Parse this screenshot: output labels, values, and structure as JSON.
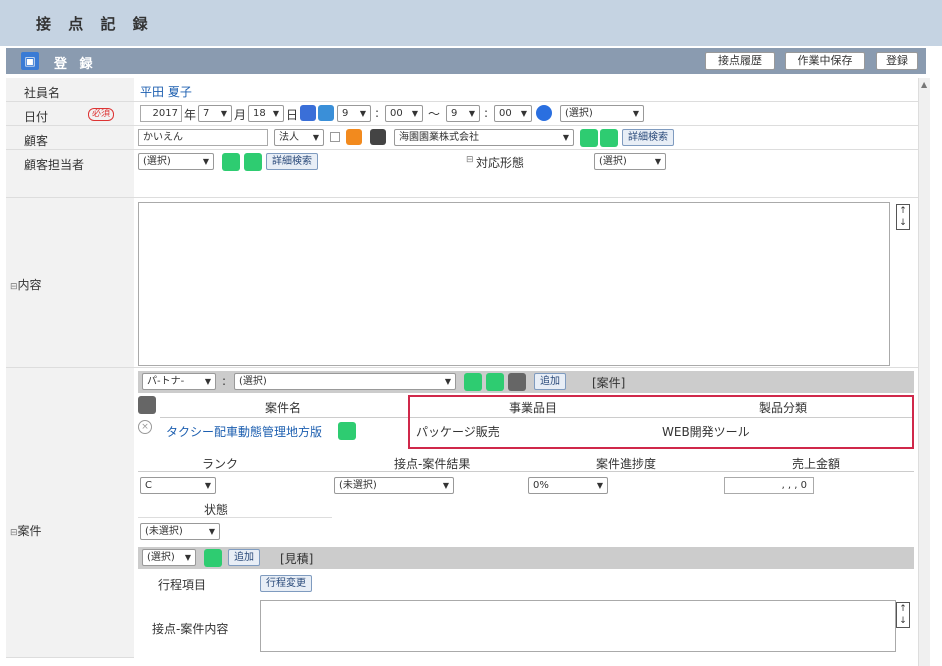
{
  "header": {
    "title": "接 点 記 録"
  },
  "register_bar": {
    "label": "登 録",
    "history": "接点履歴",
    "save_wip": "作業中保存",
    "register": "登録"
  },
  "labels": {
    "employee": "社員名",
    "date": "日付",
    "required": "必須",
    "customer": "顧客",
    "contact_person": "顧客担当者",
    "content": "内容",
    "case": "案件"
  },
  "employee_name": "平田 夏子",
  "date_row": {
    "year": "2017",
    "y": "年",
    "month": "7",
    "m": "月",
    "day": "18",
    "d": "日",
    "h1": "9",
    "c1": ":",
    "min1": "00",
    "tilde": "〜",
    "h2": "9",
    "c2": ":",
    "min2": "00",
    "select": "(選択)"
  },
  "customer_row": {
    "name": "かいえん",
    "type": "法人",
    "company": "海園園業株式会社",
    "detail_search": "詳細検索"
  },
  "contact_row": {
    "select": "(選択)",
    "detail_search": "詳細検索",
    "mode_label": "対応形態",
    "mode_select": "(選択)"
  },
  "case_section": {
    "partner": "パ-トナ-",
    "colon": ":",
    "partner_select": "(選択)",
    "add": "追加",
    "case_tag": "[案件]",
    "table_headers": [
      "案件名",
      "事業品目",
      "製品分類"
    ],
    "row": {
      "name": "タクシー配車動態管理地方版",
      "item": "パッケージ販売",
      "category": "WEB開発ツール"
    },
    "sub_headers": [
      "ランク",
      "接点-案件結果",
      "案件進捗度",
      "売上金額"
    ],
    "sub_values": {
      "rank": "C",
      "result": "(未選択)",
      "progress": "0%",
      "amount": ",  ,  , 0"
    },
    "status_label": "状態",
    "status_value": "(未選択)",
    "estimate_select": "(選択)",
    "estimate_add": "追加",
    "estimate_tag": "[見積]",
    "itinerary_label": "行程項目",
    "itinerary_change": "行程変更",
    "case_content_label": "接点-案件内容"
  }
}
